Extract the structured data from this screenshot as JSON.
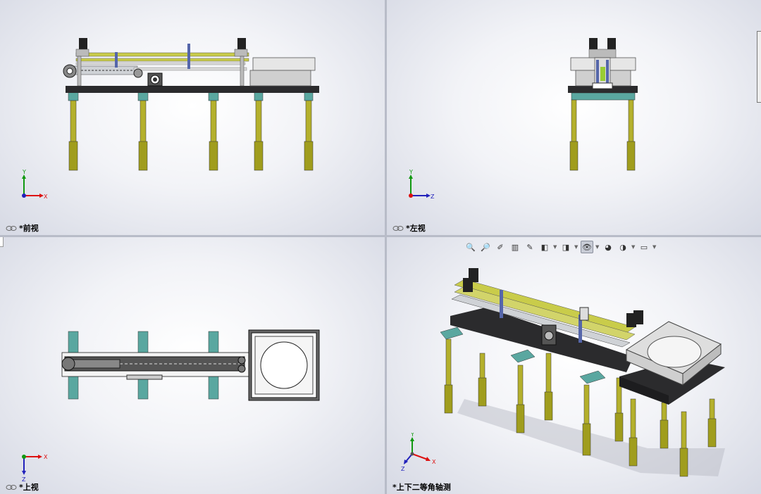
{
  "viewports": {
    "front": {
      "label": "*前视",
      "axis_up": "Y",
      "axis_right": "X"
    },
    "left": {
      "label": "*左视",
      "axis_up": "Y",
      "axis_right": "Z"
    },
    "top": {
      "label": "*上视",
      "axis_up": "X",
      "axis_down": "Z"
    },
    "iso": {
      "label": "*上下二等角轴测",
      "axis_up": "Y",
      "axis_right": "X",
      "axis_down": "Z"
    }
  },
  "toolbar": {
    "items": [
      {
        "name": "zoom-to-fit-icon",
        "glyph": "🔍"
      },
      {
        "name": "zoom-to-area-icon",
        "glyph": "🔎"
      },
      {
        "name": "previous-view-icon",
        "glyph": "✐"
      },
      {
        "name": "section-view-icon",
        "glyph": "▥"
      },
      {
        "name": "dynamic-annotation-icon",
        "glyph": "✎"
      },
      {
        "name": "view-orientation-icon",
        "glyph": "◧"
      },
      {
        "name": "display-style-icon",
        "glyph": "◨"
      },
      {
        "name": "hide-show-items-icon",
        "glyph": "👁"
      },
      {
        "name": "edit-appearance-icon",
        "glyph": "◕"
      },
      {
        "name": "apply-scene-icon",
        "glyph": "◑"
      },
      {
        "name": "view-settings-icon",
        "glyph": "▭"
      }
    ]
  },
  "colors": {
    "leg": "#9d9a1e",
    "foot": "#6b6a12",
    "cap": "#5aa7a0",
    "plate": "#2b2b2d",
    "rail": "#c9cc4a",
    "hopper": "#d8d8d8",
    "x_axis": "#d11",
    "y_axis": "#191",
    "z_axis": "#22b"
  }
}
